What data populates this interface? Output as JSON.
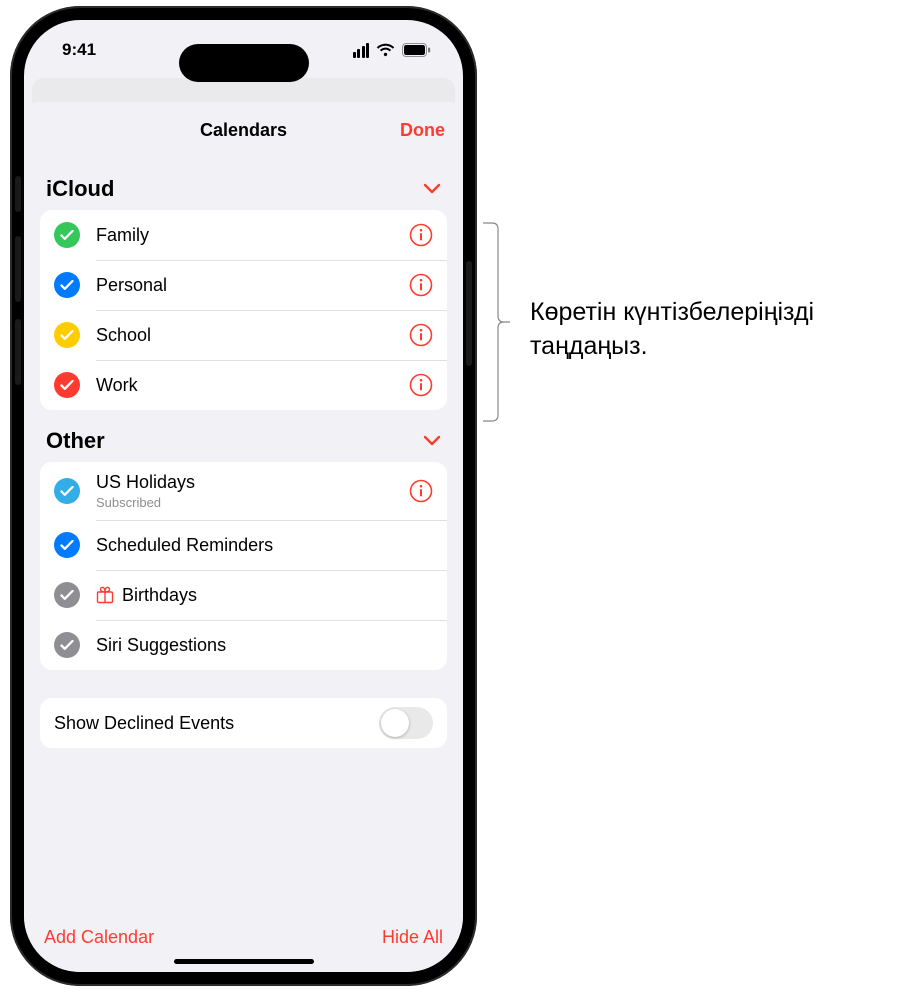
{
  "status": {
    "time": "9:41"
  },
  "sheet": {
    "title": "Calendars",
    "done": "Done"
  },
  "sections": {
    "icloud": {
      "title": "iCloud",
      "items": [
        {
          "label": "Family",
          "color": "#34c759",
          "has_info": true
        },
        {
          "label": "Personal",
          "color": "#007aff",
          "has_info": true
        },
        {
          "label": "School",
          "color": "#ffcc00",
          "has_info": true
        },
        {
          "label": "Work",
          "color": "#ff3b30",
          "has_info": true
        }
      ]
    },
    "other": {
      "title": "Other",
      "items": [
        {
          "label": "US Holidays",
          "sub": "Subscribed",
          "color": "#32ade6",
          "has_info": true
        },
        {
          "label": "Scheduled Reminders",
          "color": "#007aff",
          "has_info": false
        },
        {
          "label": "Birthdays",
          "color": "#8e8e93",
          "has_info": false,
          "gift": true
        },
        {
          "label": "Siri Suggestions",
          "color": "#8e8e93",
          "has_info": false
        }
      ]
    }
  },
  "toggle": {
    "label": "Show Declined Events",
    "on": false
  },
  "footer": {
    "add": "Add Calendar",
    "hide": "Hide All"
  },
  "callout": {
    "line1": "Көретін күнтізбелеріңізді",
    "line2": "таңдаңыз."
  }
}
